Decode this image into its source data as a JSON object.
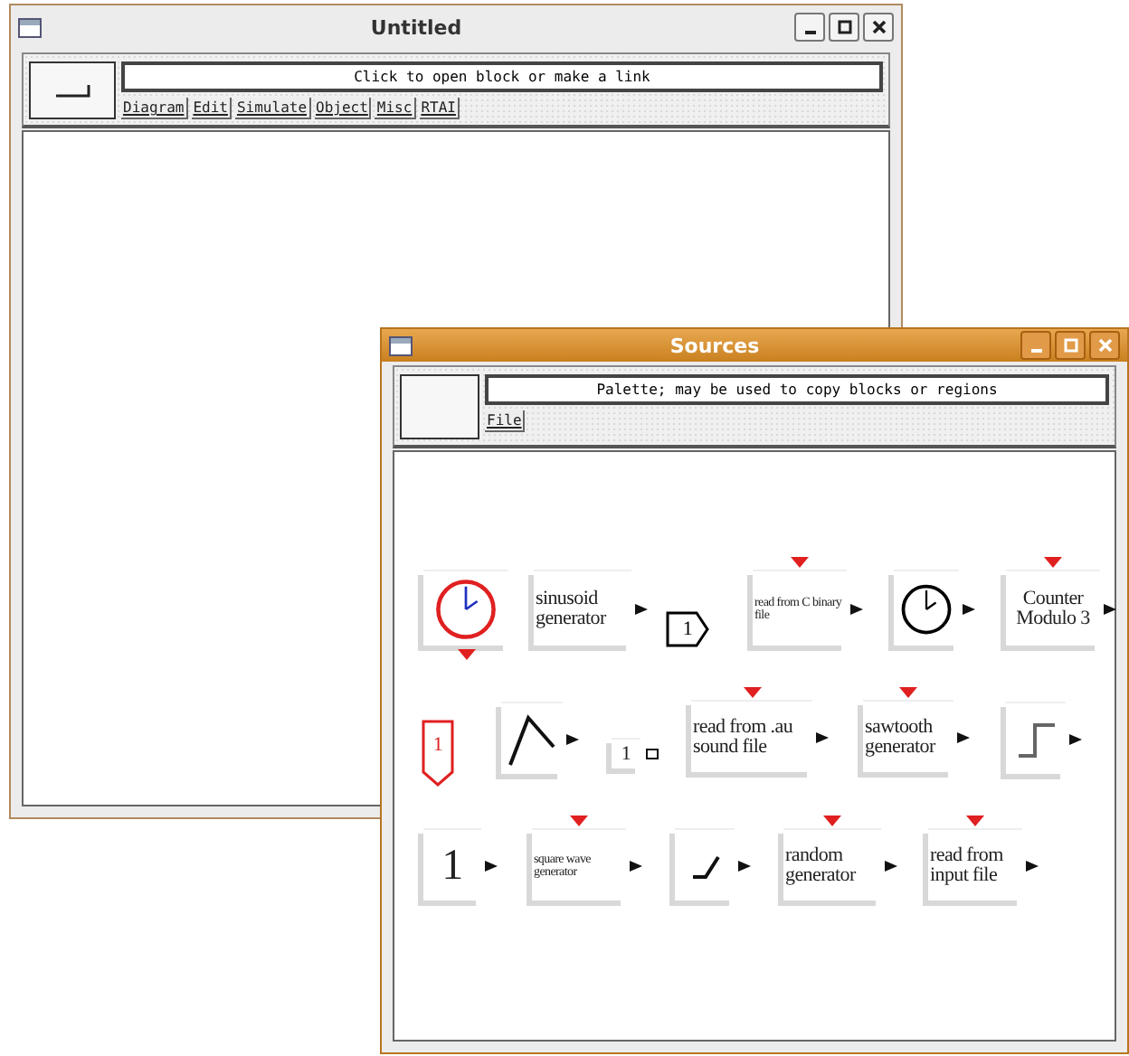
{
  "windows": [
    {
      "title": "Untitled",
      "active": false,
      "message": "Click to open block or make a link",
      "menu": [
        {
          "label": "Diagram"
        },
        {
          "label": "Edit"
        },
        {
          "label": "Simulate"
        },
        {
          "label": "Object"
        },
        {
          "label": "Misc"
        },
        {
          "label": "RTAI"
        }
      ]
    },
    {
      "title": "Sources",
      "active": true,
      "message": "Palette; may be used to copy  blocks or regions",
      "menu": [
        {
          "label": "File"
        }
      ],
      "blocks": [
        {
          "kind": "clock",
          "color": "#e02020",
          "input_top": false,
          "input_bottom": true,
          "output": false
        },
        {
          "kind": "text",
          "label": "sinusoid generator",
          "input_top": false,
          "output": true
        },
        {
          "kind": "outport",
          "label": "1",
          "color": "#000000"
        },
        {
          "kind": "smalltext",
          "label": "read from C binary file",
          "input_top": true,
          "output": true
        },
        {
          "kind": "clock",
          "color": "#000000",
          "input_top": false,
          "input_bottom": false,
          "output": true
        },
        {
          "kind": "text",
          "label": "Counter Modulo 3",
          "input_top": true,
          "output": true
        },
        {
          "kind": "inport",
          "label": "1",
          "color": "#e02020"
        },
        {
          "kind": "triangle",
          "input_top": false,
          "output": true
        },
        {
          "kind": "smallconst",
          "label": "1",
          "input_top": false,
          "output": true
        },
        {
          "kind": "text",
          "label": "read from .au sound file",
          "input_top": true,
          "output": true
        },
        {
          "kind": "text",
          "label": "sawtooth generator",
          "input_top": true,
          "output": true
        },
        {
          "kind": "step",
          "input_top": false,
          "output": true
        },
        {
          "kind": "const",
          "label": "1",
          "input_top": false,
          "output": true
        },
        {
          "kind": "smalltext",
          "label": "square wave generator",
          "input_top": true,
          "output": true
        },
        {
          "kind": "ramp",
          "input_top": false,
          "output": true
        },
        {
          "kind": "text",
          "label": "random generator",
          "input_top": true,
          "output": true
        },
        {
          "kind": "text",
          "label": "read from input file",
          "input_top": true,
          "output": true
        }
      ]
    }
  ]
}
